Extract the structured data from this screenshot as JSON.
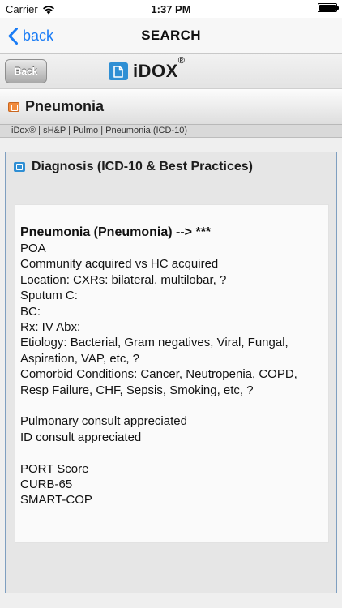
{
  "status_bar": {
    "carrier": "Carrier",
    "time": "1:37 PM"
  },
  "nav": {
    "back_label": "back",
    "title": "SEARCH"
  },
  "app_header": {
    "back_label": "Back",
    "brand": "iDOX",
    "brand_mark": "®"
  },
  "section": {
    "title": "Pneumonia"
  },
  "breadcrumb": "iDox® | sH&P | Pulmo | Pneumonia (ICD-10)",
  "panel": {
    "title": "Diagnosis (ICD-10 & Best Practices)",
    "heading": "Pneumonia (Pneumonia) --> ***",
    "lines": [
      "POA",
      "Community acquired vs HC acquired",
      "Location: CXRs: bilateral, multilobar, ?",
      "Sputum C:",
      "BC:",
      "Rx: IV Abx:",
      "Etiology: Bacterial, Gram negatives, Viral, Fungal,",
      "Aspiration, VAP, etc, ?",
      "Comorbid Conditions: Cancer, Neutropenia, COPD,",
      "Resp Failure, CHF, Sepsis, Smoking, etc, ?",
      "",
      "Pulmonary consult appreciated",
      "ID consult appreciated",
      "",
      "PORT Score",
      "CURB-65",
      "SMART-COP"
    ]
  },
  "icons": {
    "wifi": "wifi-icon",
    "battery": "battery-icon",
    "back_chevron": "chevron-left-icon",
    "brand": "document-icon",
    "section": "document-icon",
    "panel": "document-icon"
  },
  "colors": {
    "ios_blue": "#1a7cf5",
    "brand_blue": "#2f8fd4",
    "section_orange": "#f08a3c",
    "divider_blue": "#3c5f8e"
  },
  "battery_level": 1.0
}
